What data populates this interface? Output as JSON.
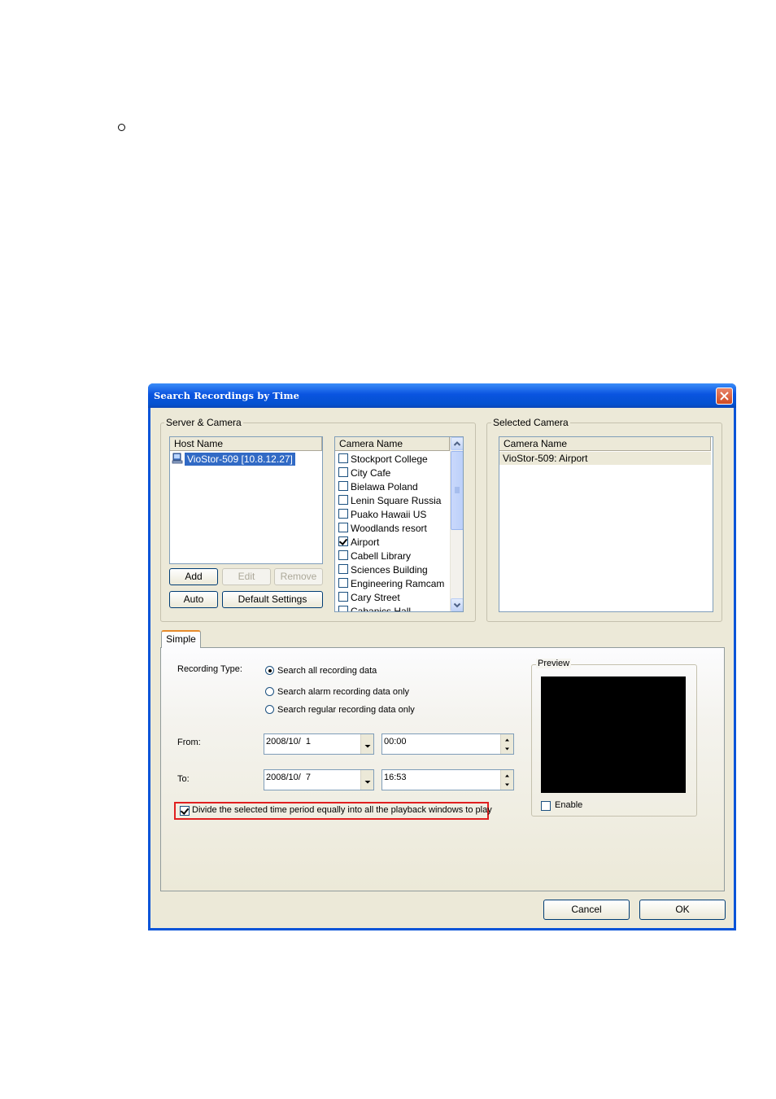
{
  "dialog": {
    "title": "Search Recordings by Time",
    "close_icon": "close-icon",
    "colors": {
      "title_bar": "#0a54d8",
      "face": "#ece9d8",
      "selection": "#316ac5",
      "highlight": "#e02020"
    }
  },
  "server_camera": {
    "legend": "Server & Camera",
    "host_header": "Host Name",
    "hosts": [
      {
        "icon": "server-icon",
        "label": "VioStor-509 [10.8.12.27]",
        "selected": true
      }
    ],
    "camera_header": "Camera Name",
    "cameras": [
      {
        "label": "Stockport College",
        "checked": false
      },
      {
        "label": "City Cafe",
        "checked": false
      },
      {
        "label": "Bielawa Poland",
        "checked": false
      },
      {
        "label": "Lenin Square Russia",
        "checked": false
      },
      {
        "label": "Puako Hawaii US",
        "checked": false
      },
      {
        "label": "Woodlands resort",
        "checked": false
      },
      {
        "label": "Airport",
        "checked": true
      },
      {
        "label": "Cabell Library",
        "checked": false
      },
      {
        "label": "Sciences Building",
        "checked": false
      },
      {
        "label": "Engineering Ramcam",
        "checked": false
      },
      {
        "label": "Cary Street",
        "checked": false
      },
      {
        "label": "Cabanics Hall",
        "checked": false
      }
    ],
    "buttons": {
      "add": "Add",
      "edit": "Edit",
      "remove": "Remove",
      "auto": "Auto",
      "default_settings": "Default Settings"
    }
  },
  "selected_camera": {
    "legend": "Selected Camera",
    "header": "Camera Name",
    "items": [
      "VioStor-509: Airport"
    ]
  },
  "tabs": [
    {
      "label": "Simple",
      "active": true
    }
  ],
  "simple": {
    "recording_type_label": "Recording Type:",
    "options": [
      {
        "label": "Search all recording data",
        "selected": true
      },
      {
        "label": "Search alarm recording data only",
        "selected": false
      },
      {
        "label": "Search regular recording data only",
        "selected": false
      }
    ],
    "from_label": "From:",
    "from_date": "2008/10/  1",
    "from_time": "00:00",
    "to_label": "To:",
    "to_date": "2008/10/  7",
    "to_time": "16:53",
    "divide_label": "Divide the selected time period equally into all the playback windows to play",
    "divide_checked": true
  },
  "preview": {
    "legend": "Preview",
    "enable_label": "Enable",
    "enable_checked": false
  },
  "footer": {
    "cancel": "Cancel",
    "ok": "OK"
  }
}
